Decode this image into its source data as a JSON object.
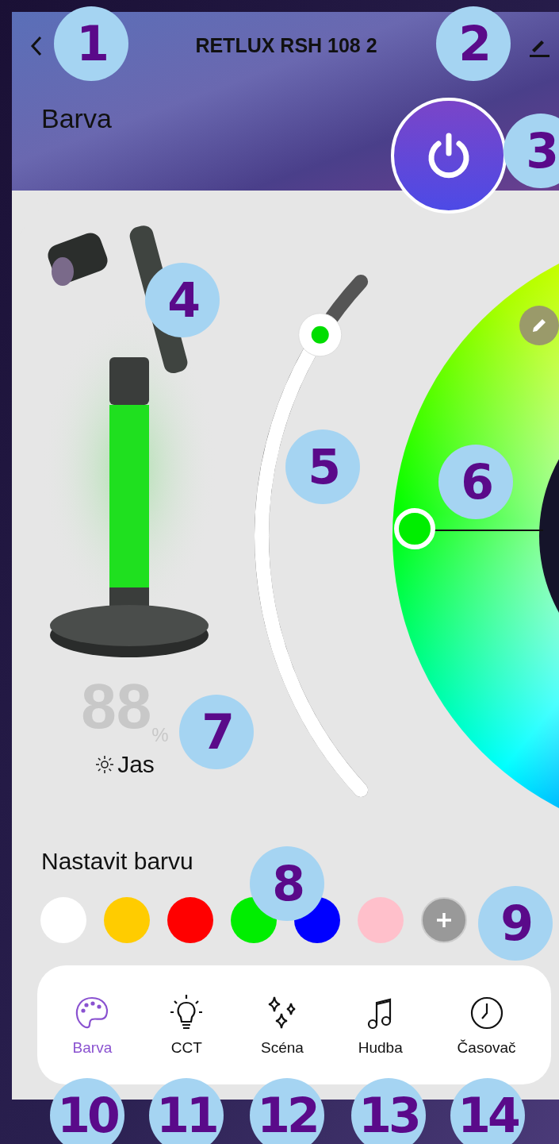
{
  "header": {
    "title": "RETLUX RSH 108 2",
    "section": "Barva"
  },
  "brightness": {
    "value": "88",
    "unit": "%",
    "label": "Jas",
    "level": 0.88
  },
  "presets": {
    "title": "Nastavit barvu",
    "swatches": [
      {
        "color": "#ffffff"
      },
      {
        "color": "#ffcc00"
      },
      {
        "color": "#ff0000"
      },
      {
        "color": "#00ee00"
      },
      {
        "color": "#0000ff"
      },
      {
        "color": "#ffc0cb"
      }
    ]
  },
  "tabs": [
    {
      "label": "Barva",
      "kind": "palette",
      "selected": true
    },
    {
      "label": "CCT",
      "kind": "bulb",
      "selected": false
    },
    {
      "label": "Scéna",
      "kind": "sparkles",
      "selected": false
    },
    {
      "label": "Hudba",
      "kind": "music",
      "selected": false
    },
    {
      "label": "Časovač",
      "kind": "clock",
      "selected": false
    }
  ],
  "callouts": [
    {
      "label": "1"
    },
    {
      "label": "2"
    },
    {
      "label": "3"
    },
    {
      "label": "4"
    },
    {
      "label": "5"
    },
    {
      "label": "6"
    },
    {
      "label": "7"
    },
    {
      "label": "8"
    },
    {
      "label": "9"
    },
    {
      "label": "10"
    },
    {
      "label": "11"
    },
    {
      "label": "12"
    },
    {
      "label": "13"
    },
    {
      "label": "14"
    }
  ]
}
